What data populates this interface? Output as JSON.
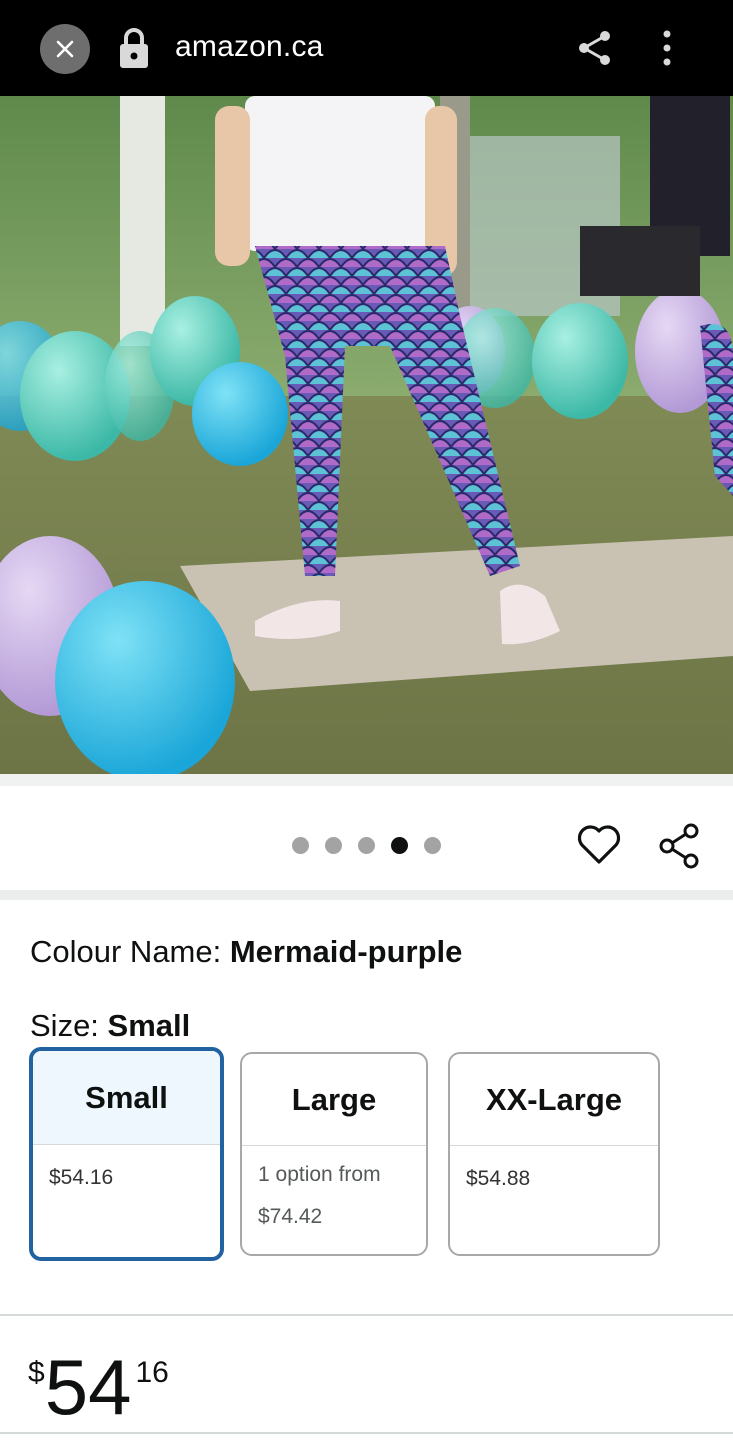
{
  "browser": {
    "url": "amazon.ca",
    "icons": [
      "close-icon",
      "lock-icon",
      "share-icon",
      "more-vert-icon"
    ]
  },
  "gallery": {
    "image_count": 5,
    "active_index": 3,
    "icons": [
      "heart-icon",
      "share-icon"
    ]
  },
  "variant": {
    "colour_label": "Colour Name: ",
    "colour_value": "Mermaid-purple",
    "size_label": "Size: ",
    "size_value": "Small"
  },
  "sizes": [
    {
      "name": "Small",
      "price": "$54.16",
      "selected": true
    },
    {
      "name": "Large",
      "note": "1 option from",
      "price": "$74.42",
      "selected": false
    },
    {
      "name": "XX-Large",
      "price": "$54.88",
      "selected": false
    }
  ],
  "price": {
    "symbol": "$",
    "whole": "54",
    "fraction": "16"
  },
  "colors": {
    "selected_border": "#2162a1",
    "selected_fill": "#edf7fd",
    "topbar": "#000000"
  }
}
